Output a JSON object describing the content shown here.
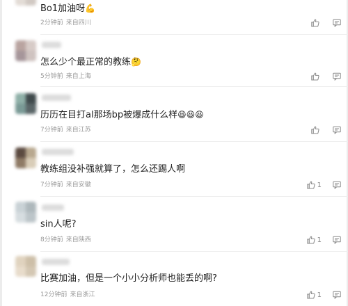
{
  "comments": [
    {
      "text": "Bo1加油呀",
      "emoji": "💪",
      "time": "2分钟前",
      "source": "来自四川",
      "like_count": ""
    },
    {
      "text": "怎么少个最正常的教练",
      "emoji": "🤔",
      "time": "5分钟前",
      "source": "来自上海",
      "like_count": ""
    },
    {
      "text": "历历在目打al那场bp被爆成什么样",
      "emoji": "😆😆😆",
      "time": "7分钟前",
      "source": "来自江苏",
      "like_count": ""
    },
    {
      "text": "教练组没补强就算了，怎么还踢人啊",
      "emoji": "",
      "time": "7分钟前",
      "source": "来自安徽",
      "like_count": "1"
    },
    {
      "text": "sin人呢?",
      "emoji": "",
      "time": "8分钟前",
      "source": "来自陕西",
      "like_count": "1"
    },
    {
      "text": "比赛加油，但是一个小小分析师也能丢的啊?",
      "emoji": "",
      "time": "12分钟前",
      "source": "来自浙江",
      "like_count": "1"
    }
  ],
  "icons": {
    "like": "thumbs-up-icon",
    "reply": "reply-icon"
  },
  "colors": {
    "text": "#222222",
    "meta": "#9a9a9a",
    "icon": "#888888"
  }
}
